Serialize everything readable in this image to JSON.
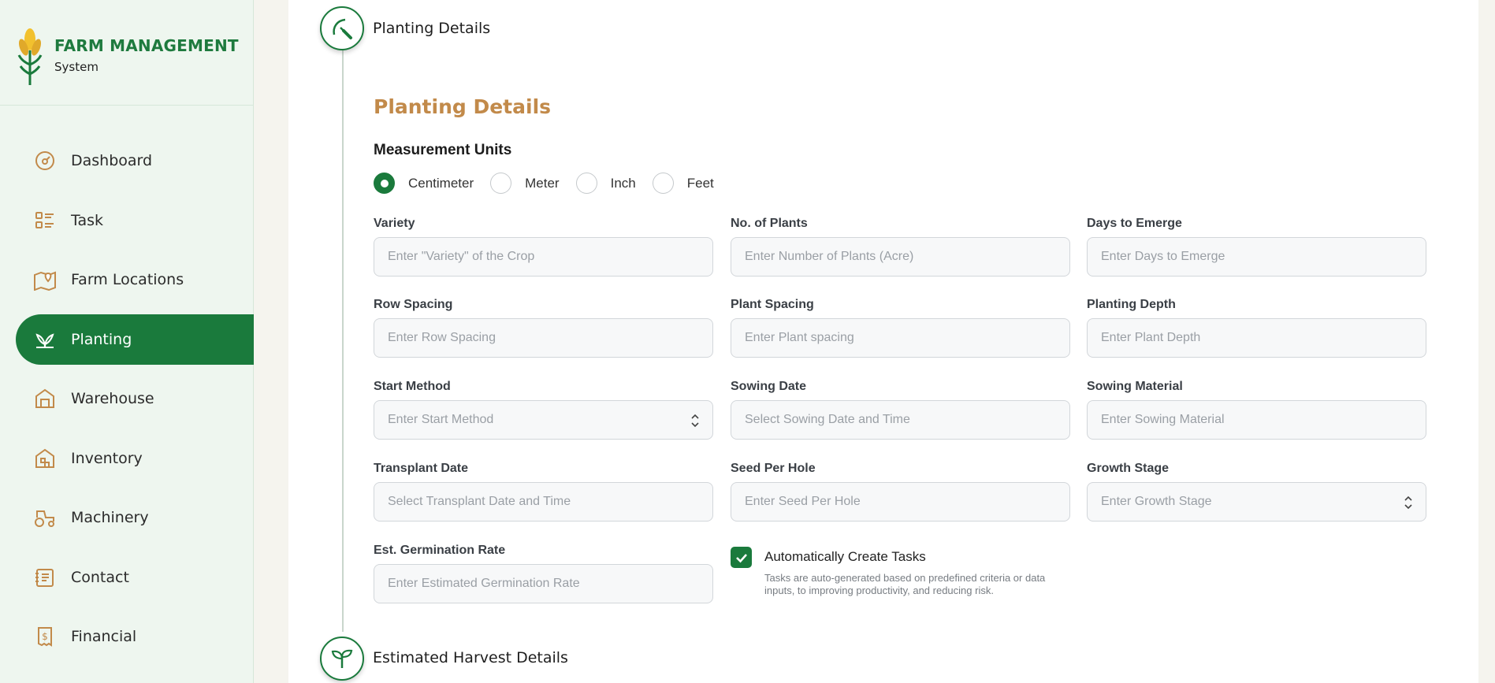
{
  "brand": {
    "title": "FARM MANAGEMENT",
    "subtitle": "System"
  },
  "sidebar": {
    "items": [
      {
        "label": "Dashboard",
        "icon": "dashboard-gauge-icon",
        "active": false
      },
      {
        "label": "Task",
        "icon": "task-list-icon",
        "active": false
      },
      {
        "label": "Farm Locations",
        "icon": "map-pin-icon",
        "active": false
      },
      {
        "label": "Planting",
        "icon": "plant-sprout-icon",
        "active": true
      },
      {
        "label": "Warehouse",
        "icon": "warehouse-icon",
        "active": false
      },
      {
        "label": "Inventory",
        "icon": "inventory-icon",
        "active": false
      },
      {
        "label": "Machinery",
        "icon": "tractor-icon",
        "active": false
      },
      {
        "label": "Contact",
        "icon": "contact-book-icon",
        "active": false
      },
      {
        "label": "Financial",
        "icon": "dollar-receipt-icon",
        "active": false
      }
    ]
  },
  "steps": {
    "planting_title": "Planting Details",
    "harvest_title": "Estimated Harvest Details"
  },
  "form": {
    "section_title": "Planting Details",
    "units_title": "Measurement Units",
    "units": [
      {
        "label": "Centimeter",
        "checked": true
      },
      {
        "label": "Meter",
        "checked": false
      },
      {
        "label": "Inch",
        "checked": false
      },
      {
        "label": "Feet",
        "checked": false
      }
    ],
    "fields": {
      "variety": {
        "label": "Variety",
        "placeholder": "Enter \"Variety\" of the Crop"
      },
      "no_of_plants": {
        "label": "No. of Plants",
        "placeholder": "Enter Number of Plants (Acre)"
      },
      "days_to_emerge": {
        "label": "Days to Emerge",
        "placeholder": "Enter Days to Emerge"
      },
      "row_spacing": {
        "label": "Row Spacing",
        "placeholder": "Enter Row Spacing"
      },
      "plant_spacing": {
        "label": "Plant Spacing",
        "placeholder": "Enter Plant spacing"
      },
      "planting_depth": {
        "label": "Planting Depth",
        "placeholder": "Enter Plant Depth"
      },
      "start_method": {
        "label": "Start Method",
        "placeholder": "Enter Start Method"
      },
      "sowing_date": {
        "label": "Sowing Date",
        "placeholder": "Select Sowing Date and Time"
      },
      "sowing_material": {
        "label": "Sowing Material",
        "placeholder": "Enter Sowing Material"
      },
      "transplant_date": {
        "label": "Transplant Date",
        "placeholder": "Select Transplant Date and Time"
      },
      "seed_per_hole": {
        "label": "Seed Per Hole",
        "placeholder": "Enter Seed Per Hole"
      },
      "growth_stage": {
        "label": "Growth Stage",
        "placeholder": "Enter Growth Stage"
      },
      "germination_rate": {
        "label": "Est. Germination Rate",
        "placeholder": "Enter Estimated Germination Rate"
      }
    },
    "auto_tasks": {
      "label": "Automatically Create Tasks",
      "checked": true,
      "description": "Tasks are auto-generated based on predefined criteria or data inputs, to improving productivity, and reducing risk."
    }
  },
  "colors": {
    "primary": "#1a7a3c",
    "accent": "#c28a4a",
    "sidebar_bg": "#eef6ef"
  }
}
